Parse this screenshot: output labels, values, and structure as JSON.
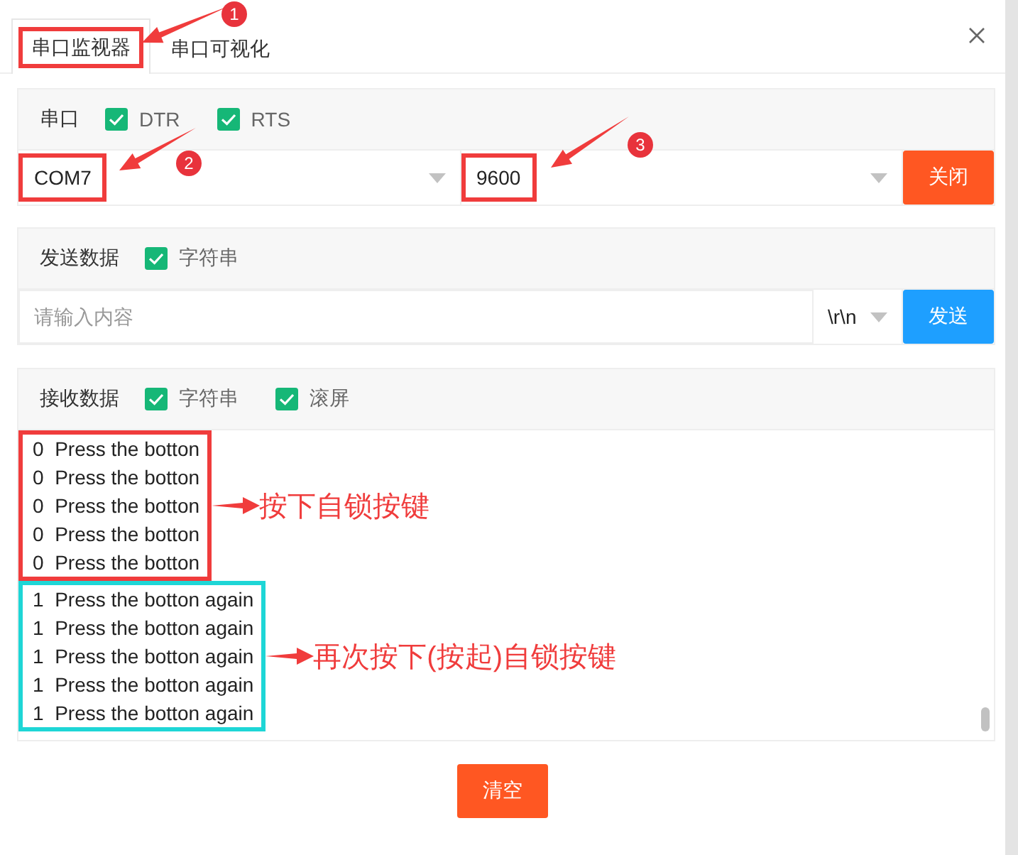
{
  "tabs": [
    {
      "label": "串口监视器",
      "selected": true,
      "highlighted": true
    },
    {
      "label": "串口可视化",
      "selected": false,
      "highlighted": false
    }
  ],
  "port_panel": {
    "label": "串口",
    "options": [
      {
        "label": "DTR",
        "checked": true
      },
      {
        "label": "RTS",
        "checked": true
      }
    ],
    "port": {
      "value": "COM7",
      "highlighted": true
    },
    "baud": {
      "value": "9600",
      "highlighted": true
    },
    "button": "关闭"
  },
  "send_panel": {
    "label": "发送数据",
    "options": [
      {
        "label": "字符串",
        "checked": true
      }
    ],
    "input": {
      "placeholder": "请输入内容"
    },
    "line_ending": {
      "value": "\\r\\n"
    },
    "button": "发送"
  },
  "receive_panel": {
    "label": "接收数据",
    "options": [
      {
        "label": "字符串",
        "checked": true
      },
      {
        "label": "滚屏",
        "checked": true
      }
    ],
    "groups": [
      {
        "color": "#f03c3c",
        "note": "按下自锁按键",
        "lines": [
          {
            "code": "0",
            "text": "Press the botton"
          },
          {
            "code": "0",
            "text": "Press the botton"
          },
          {
            "code": "0",
            "text": "Press the botton"
          },
          {
            "code": "0",
            "text": "Press the botton"
          },
          {
            "code": "0",
            "text": "Press the botton"
          }
        ]
      },
      {
        "color": "#1ed6d6",
        "note": "再次按下(按起)自锁按键",
        "lines": [
          {
            "code": "1",
            "text": "Press the botton again"
          },
          {
            "code": "1",
            "text": "Press the botton again"
          },
          {
            "code": "1",
            "text": "Press the botton again"
          },
          {
            "code": "1",
            "text": "Press the botton again"
          },
          {
            "code": "1",
            "text": "Press the botton again"
          }
        ]
      }
    ]
  },
  "clear_button": "清空",
  "callouts": [
    {
      "number": "1"
    },
    {
      "number": "2"
    },
    {
      "number": "3"
    }
  ]
}
